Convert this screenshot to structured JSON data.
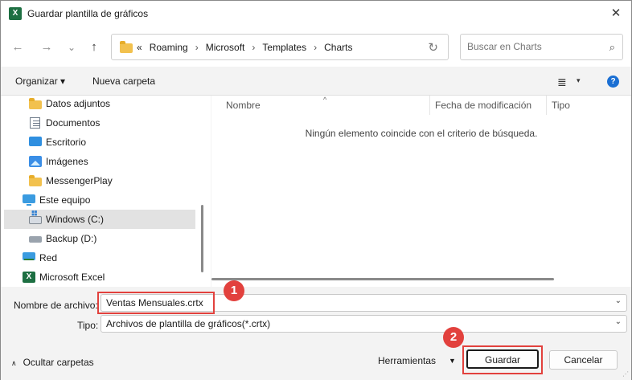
{
  "window": {
    "title": "Guardar plantilla de gráficos",
    "app_icon": "X",
    "close_glyph": "✕"
  },
  "nav": {
    "back_glyph": "←",
    "forward_glyph": "→",
    "recent_glyph": "⌄",
    "up_glyph": "↑",
    "overflow": "«",
    "breadcrumbs": [
      "Roaming",
      "Microsoft",
      "Templates",
      "Charts"
    ],
    "separator": "›",
    "refresh_glyph": "↻",
    "search_placeholder": "Buscar en Charts",
    "search_glyph": "⌕"
  },
  "commandbar": {
    "organize_label": "Organizar ▾",
    "new_folder_label": "Nueva carpeta",
    "view_glyph": "≣",
    "view_caret": "▾",
    "help_glyph": "?"
  },
  "sidebar": {
    "items": [
      {
        "label": "Datos adjuntos",
        "icon": "folder-icon"
      },
      {
        "label": "Documentos",
        "icon": "documents-icon"
      },
      {
        "label": "Escritorio",
        "icon": "desktop-icon"
      },
      {
        "label": "Imágenes",
        "icon": "pictures-icon"
      },
      {
        "label": "MessengerPlay",
        "icon": "folder-icon"
      },
      {
        "label": "Este equipo",
        "icon": "this-pc-icon"
      },
      {
        "label": "Windows (C:)",
        "icon": "drive-icon",
        "selected": true
      },
      {
        "label": "Backup (D:)",
        "icon": "usb-drive-icon"
      },
      {
        "label": "Red",
        "icon": "network-icon"
      },
      {
        "label": "Microsoft Excel",
        "icon": "excel-icon"
      }
    ],
    "excel_icon_letter": "X"
  },
  "filelist": {
    "columns": [
      "Nombre",
      "Fecha de modificación",
      "Tipo"
    ],
    "sort_glyph": "^",
    "empty_message": "Ningún elemento coincide con el criterio de búsqueda."
  },
  "form": {
    "filename_label": "Nombre de archivo:",
    "filename_value": "Ventas Mensuales.crtx",
    "type_label": "Tipo:",
    "type_value": "Archivos de plantilla de gráficos(*.crtx)",
    "dropdown_glyph": "⌄",
    "hide_folders_caret": "∧",
    "hide_folders_label": "Ocultar carpetas",
    "tools_label": "Herramientas",
    "tools_caret": "▼",
    "save_label": "Guardar",
    "cancel_label": "Cancelar",
    "grip_glyph": "⋰"
  },
  "annotations": {
    "badge_1": "1",
    "badge_2": "2",
    "highlight_color": "#e2413d"
  },
  "colors": {
    "excel_green": "#1d6f42",
    "folder_yellow": "#f2c14e",
    "help_blue": "#1a6fd3"
  }
}
